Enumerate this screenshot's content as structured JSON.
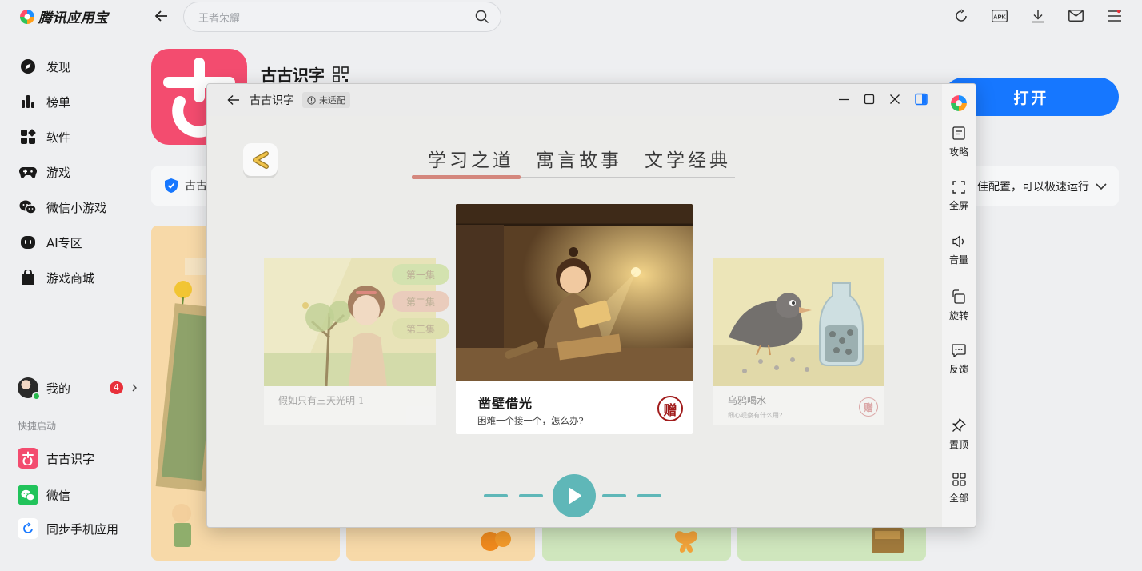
{
  "app_store": {
    "logo_text": "腾讯应用宝",
    "search_placeholder": "王者荣耀",
    "nav": [
      {
        "label": "发现",
        "icon": "compass-icon"
      },
      {
        "label": "榜单",
        "icon": "bar-chart-icon"
      },
      {
        "label": "软件",
        "icon": "apps-grid-icon"
      },
      {
        "label": "游戏",
        "icon": "gamepad-icon"
      },
      {
        "label": "微信小游戏",
        "icon": "wechat-icon"
      },
      {
        "label": "AI专区",
        "icon": "ai-bot-icon"
      },
      {
        "label": "游戏商城",
        "icon": "shopping-bag-icon"
      }
    ],
    "my": {
      "label": "我的",
      "badge": "4"
    },
    "quick_launch_title": "快捷启动",
    "quick_launch": [
      {
        "label": "古古识字",
        "icon": "gugu-app-icon"
      },
      {
        "label": "微信",
        "icon": "wechat-app-icon"
      },
      {
        "label": "同步手机应用",
        "icon": "sync-phone-icon"
      }
    ],
    "top_icons": [
      "refresh-icon",
      "apk-icon",
      "download-icon",
      "mail-icon",
      "menu-icon"
    ],
    "apk_label": "APK",
    "app_detail": {
      "name": "古古识字",
      "open_button": "打开",
      "info_left": "古古",
      "info_right": "佳配置，可以极速运行"
    }
  },
  "window": {
    "title": "古古识字",
    "badge": "未适配",
    "side_tools": [
      {
        "label": "攻略",
        "icon": "guide-icon"
      },
      {
        "label": "全屏",
        "icon": "fullscreen-icon"
      },
      {
        "label": "音量",
        "icon": "volume-icon"
      },
      {
        "label": "旋转",
        "icon": "rotate-icon"
      },
      {
        "label": "反馈",
        "icon": "feedback-icon"
      },
      {
        "label": "置顶",
        "icon": "pin-icon"
      },
      {
        "label": "全部",
        "icon": "all-apps-icon"
      }
    ]
  },
  "game": {
    "tabs": [
      "学习之道",
      "寓言故事",
      "文学经典"
    ],
    "active_tab": 0,
    "episodes": [
      "第一集",
      "第二集",
      "第三集"
    ],
    "stories": {
      "left": {
        "title": "假如只有三天光明-1"
      },
      "main": {
        "title": "凿壁借光",
        "subtitle": "困难一个接一个，怎么办?",
        "gift": "赠"
      },
      "right": {
        "title": "乌鸦喝水",
        "subtitle": "细心观察有什么用?",
        "gift": "赠"
      }
    },
    "colors": {
      "accent": "#5fb7b8",
      "tab_underline": "#d4877d",
      "gift_red": "#a11c1c"
    }
  }
}
